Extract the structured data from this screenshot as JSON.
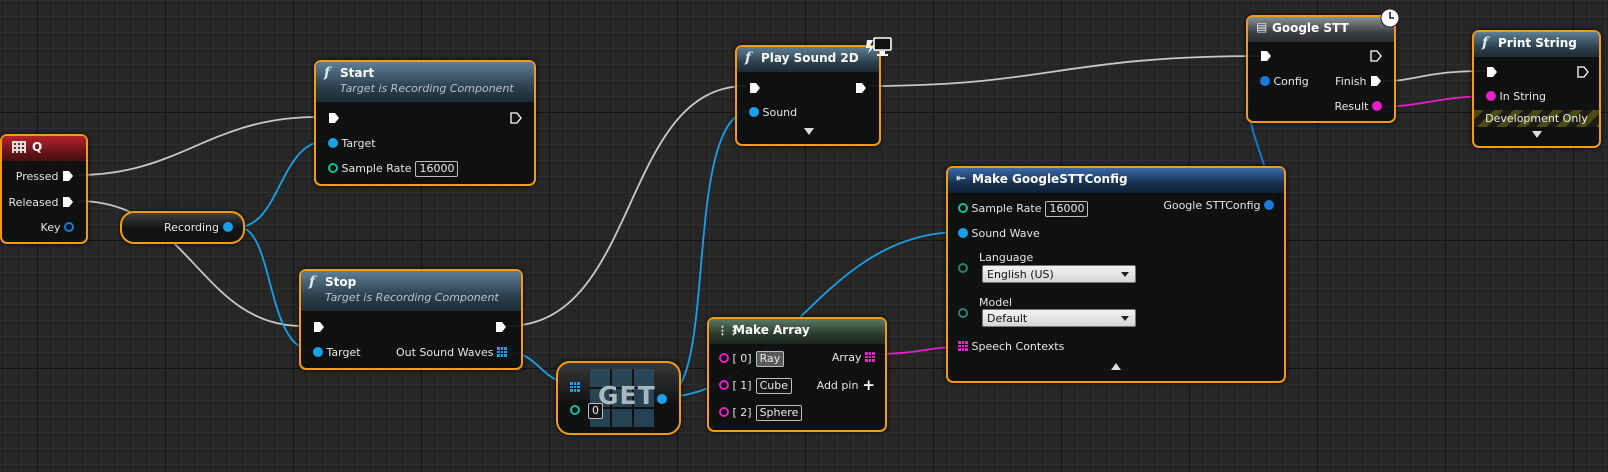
{
  "nodes": {
    "q": {
      "title": "Q",
      "pins": {
        "pressed": "Pressed",
        "released": "Released",
        "key": "Key"
      }
    },
    "recording": {
      "title": "Recording"
    },
    "start": {
      "title": "Start",
      "subtitle": "Target is Recording Component",
      "target": "Target",
      "sample_rate": "Sample Rate",
      "sample_rate_value": "16000"
    },
    "stop": {
      "title": "Stop",
      "subtitle": "Target is Recording Component",
      "target": "Target",
      "out": "Out Sound Waves"
    },
    "get": {
      "title": "GET",
      "index_value": "0"
    },
    "play_sound": {
      "title": "Play Sound 2D",
      "sound": "Sound"
    },
    "make_array": {
      "title": "Make Array",
      "items": [
        {
          "index": "[ 0]",
          "value": "Ray"
        },
        {
          "index": "[ 1]",
          "value": "Cube"
        },
        {
          "index": "[ 2]",
          "value": "Sphere"
        }
      ],
      "array": "Array",
      "add_pin": "Add pin"
    },
    "make_config": {
      "title": "Make GoogleSTTConfig",
      "sample_rate": "Sample Rate",
      "sample_rate_value": "16000",
      "sound_wave": "Sound Wave",
      "language": "Language",
      "language_value": "English (US)",
      "model": "Model",
      "model_value": "Default",
      "speech_contexts": "Speech Contexts",
      "output": "Google STTConfig"
    },
    "google_stt": {
      "title": "Google STT",
      "config": "Config",
      "finish": "Finish",
      "result": "Result"
    },
    "print_string": {
      "title": "Print String",
      "in_string": "In String",
      "dev_only": "Development Only"
    }
  },
  "colors": {
    "node_border": "#f39c12",
    "exec_wire": "#c8c8c8",
    "object_wire": "#1aa0e8",
    "string_wire": "#e61fc8"
  }
}
